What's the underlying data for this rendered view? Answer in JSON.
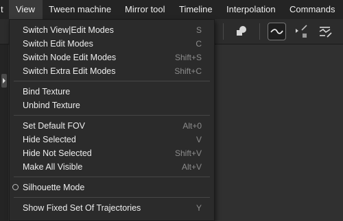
{
  "menubar": {
    "items": [
      {
        "label": "t"
      },
      {
        "label": "View"
      },
      {
        "label": "Tween machine"
      },
      {
        "label": "Mirror tool"
      },
      {
        "label": "Timeline"
      },
      {
        "label": "Interpolation"
      },
      {
        "label": "Commands"
      }
    ],
    "active": "View"
  },
  "toolbar": {
    "icons": [
      "shape-icon",
      "curve-icon",
      "select-key-icon",
      "trajectory-icon"
    ],
    "selected": "curve-icon"
  },
  "view_menu": {
    "items": [
      {
        "label": "Switch View|Edit Modes",
        "shortcut": "S"
      },
      {
        "label": "Switch Edit Modes",
        "shortcut": "C"
      },
      {
        "label": "Switch Node Edit Modes",
        "shortcut": "Shift+S"
      },
      {
        "label": "Switch Extra Edit Modes",
        "shortcut": "Shift+C"
      },
      {
        "label": "Bind Texture",
        "shortcut": ""
      },
      {
        "label": "Unbind Texture",
        "shortcut": ""
      },
      {
        "label": "Set Default FOV",
        "shortcut": "Alt+0"
      },
      {
        "label": "Hide Selected",
        "shortcut": "V"
      },
      {
        "label": "Hide Not Selected",
        "shortcut": "Shift+V"
      },
      {
        "label": "Make All Visible",
        "shortcut": "Alt+V"
      },
      {
        "label": "Silhouette Mode",
        "shortcut": "",
        "radio": true,
        "checked": false
      },
      {
        "label": "Show Fixed Set Of Trajectories",
        "shortcut": "Y"
      }
    ]
  }
}
